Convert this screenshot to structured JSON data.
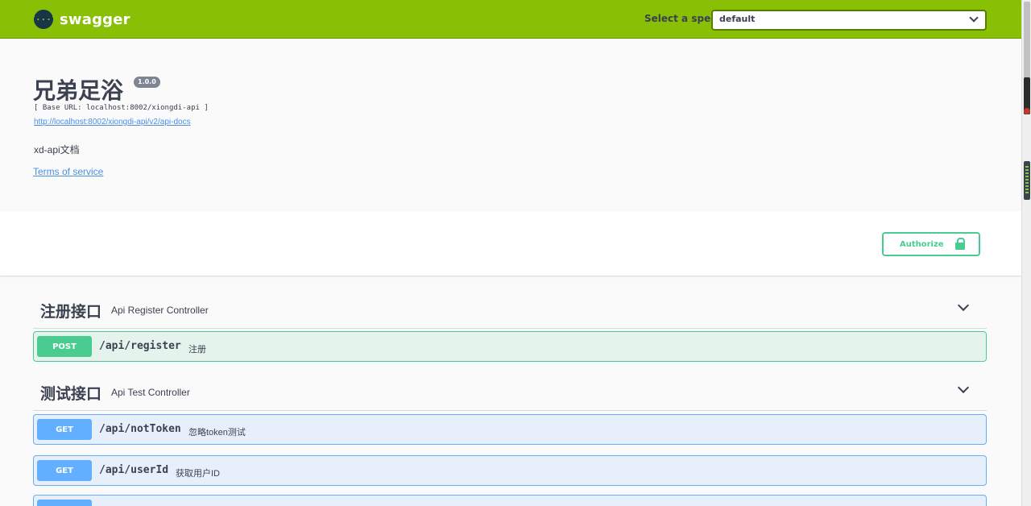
{
  "topbar": {
    "logo_glyph": "{···}",
    "logo_text": "swagger",
    "spec_label": "Select a spec",
    "spec_selected": "default",
    "brand_color": "#89bf04"
  },
  "info": {
    "title": "兄弟足浴",
    "version": "1.0.0",
    "base_url": "[ Base URL: localhost:8002/xiongdi-api ]",
    "docs_url": "http://localhost:8002/xiongdi-api/v2/api-docs",
    "description": "xd-api文档",
    "terms_label": "Terms of service"
  },
  "auth": {
    "authorize_label": "Authorize",
    "accent": "#49cc90"
  },
  "tags": [
    {
      "name": "注册接口",
      "description": "Api Register Controller",
      "operations": [
        {
          "method": "POST",
          "path": "/api/register",
          "summary": "注册"
        }
      ]
    },
    {
      "name": "测试接口",
      "description": "Api Test Controller",
      "operations": [
        {
          "method": "GET",
          "path": "/api/notToken",
          "summary": "忽略token测试"
        },
        {
          "method": "GET",
          "path": "/api/userId",
          "summary": "获取用户ID"
        },
        {
          "method": "GET",
          "path": "",
          "summary": ""
        }
      ]
    }
  ],
  "colors": {
    "post": "#49cc90",
    "get": "#61affe"
  }
}
